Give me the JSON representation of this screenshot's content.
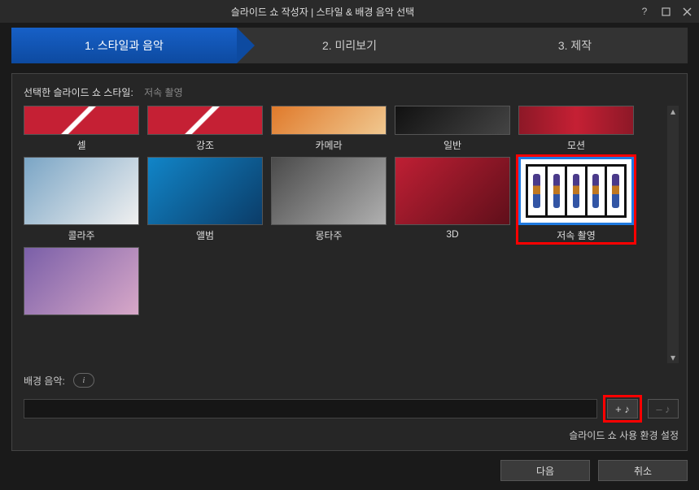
{
  "titlebar": {
    "title": "슬라이드 쇼 작성자 | 스타일 & 배경 음악 선택"
  },
  "steps": [
    {
      "label": "1. 스타일과 음악",
      "active": true
    },
    {
      "label": "2. 미리보기",
      "active": false
    },
    {
      "label": "3. 제작",
      "active": false
    }
  ],
  "style_section": {
    "label": "선택한 슬라이드 쇼 스타일:",
    "selected_name": "저속 촬영"
  },
  "styles_row1": [
    {
      "name": "셀",
      "art": "art-red"
    },
    {
      "name": "강조",
      "art": "art-red"
    },
    {
      "name": "카메라",
      "art": "art-cam"
    },
    {
      "name": "일반",
      "art": "art-norm"
    },
    {
      "name": "모션",
      "art": "art-mot"
    }
  ],
  "styles_row2": [
    {
      "name": "콜라주",
      "art": "art-col"
    },
    {
      "name": "앨범",
      "art": "art-alb"
    },
    {
      "name": "몽타주",
      "art": "art-mon"
    },
    {
      "name": "3D",
      "art": "art-3d"
    },
    {
      "name": "저속 촬영",
      "art": "art-tl",
      "selected": true,
      "highlighted": true
    }
  ],
  "styles_row3": [
    {
      "name": "",
      "art": "art-pur"
    }
  ],
  "music": {
    "label": "배경 음악:",
    "info_tooltip": "i",
    "value": "",
    "add_symbol": "+ ♪",
    "remove_symbol": "– ♪"
  },
  "prefs_link": "슬라이드 쇼 사용 환경 설정",
  "footer": {
    "next": "다음",
    "cancel": "취소"
  }
}
